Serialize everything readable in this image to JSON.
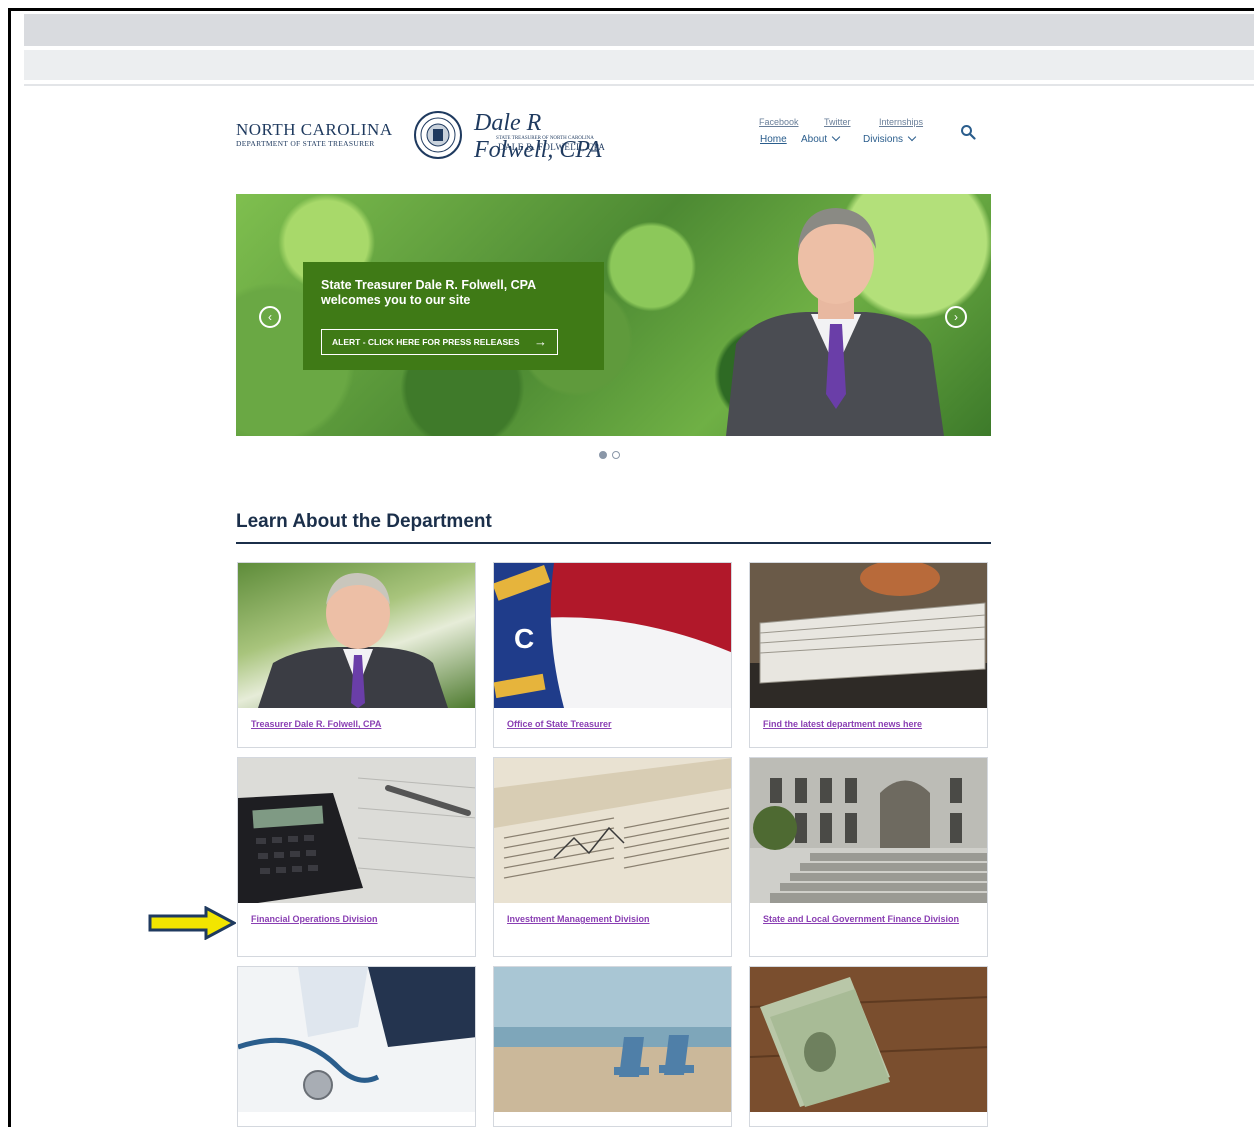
{
  "header": {
    "logo_line1": "NORTH CAROLINA",
    "logo_line2": "DEPARTMENT OF STATE TREASURER",
    "signature": "Dale R Folwell, CPA",
    "signature_sub": "STATE TREASURER OF NORTH CAROLINA",
    "signature_name": "DALE R. FOLWELL, CPA"
  },
  "social_links": [
    "Facebook",
    "Twitter",
    "Internships"
  ],
  "nav": {
    "home": "Home",
    "about": "About",
    "divisions": "Divisions"
  },
  "hero": {
    "title": "State Treasurer Dale R. Folwell, CPA welcomes you to our site",
    "button": "ALERT - CLICK HERE FOR PRESS RELEASES",
    "prev_icon": "chevron-left-icon",
    "next_icon": "chevron-right-icon",
    "slide_count": 2,
    "active_slide": 1
  },
  "section": {
    "title": "Learn About the Department"
  },
  "cards": [
    {
      "label": "Treasurer Dale R. Folwell, CPA"
    },
    {
      "label": "Office of State Treasurer"
    },
    {
      "label": "Find the latest department news here"
    },
    {
      "label": "Financial Operations Division"
    },
    {
      "label": "Investment Management Division"
    },
    {
      "label": "State and Local Government Finance Division"
    },
    {
      "label": ""
    },
    {
      "label": ""
    },
    {
      "label": ""
    }
  ],
  "colors": {
    "accent": "#1b2f4a",
    "link": "#8a3fb3",
    "hero_box": "#3f7a16",
    "indicator": "#f2e500"
  }
}
